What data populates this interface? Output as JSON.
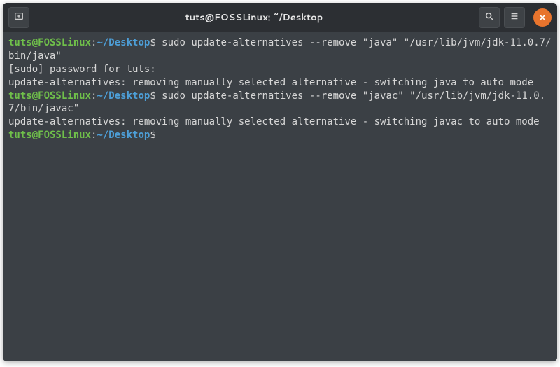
{
  "window": {
    "title": "tuts@FOSSLinux: ~/Desktop"
  },
  "prompt": {
    "user_host": "tuts@FOSSLinux",
    "separator": ":",
    "path": "~/Desktop",
    "symbol": "$"
  },
  "lines": {
    "cmd1": " sudo update-alternatives --remove \"java\" \"/usr/lib/jvm/jdk-11.0.7/bin/java\"",
    "out1a": "[sudo] password for tuts:",
    "out1b": "update-alternatives: removing manually selected alternative - switching java to auto mode",
    "cmd2": " sudo update-alternatives --remove \"javac\" \"/usr/lib/jvm/jdk-11.0.7/bin/javac\"",
    "out2a": "update-alternatives: removing manually selected alternative - switching javac to auto mode",
    "cmd3": ""
  },
  "icons": {
    "new_tab": "new-tab-icon",
    "search": "search-icon",
    "menu": "menu-icon",
    "close": "close-icon"
  }
}
